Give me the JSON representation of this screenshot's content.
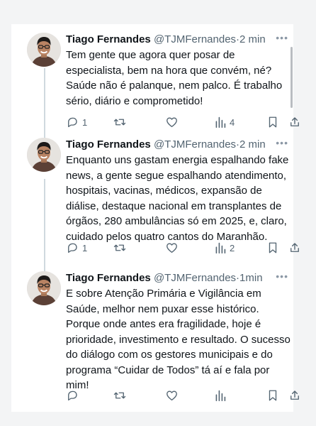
{
  "tweets": [
    {
      "name": "Tiago Fernandes",
      "handle": "@TJMFernandes",
      "separator": "·",
      "time": "2 min",
      "text": "Tem gente que agora quer posar de especialista, bem na hora que convém, né? Saúde não é palanque, nem palco. É trabalho sério, diário e comprometido!",
      "replies": "1",
      "retweets": "",
      "likes": "",
      "views": "4"
    },
    {
      "name": "Tiago Fernandes",
      "handle": "@TJMFernandes",
      "separator": "·",
      "time": "2 min",
      "text": "Enquanto uns gastam energia espalhando fake news, a gente segue espalhando atendimento, hospitais, vacinas, médicos, expansão de diálise, destaque nacional em transplantes de órgãos, 280 ambulâncias só em 2025, e, claro, cuidado pelos quatro cantos do Maranhão.",
      "replies": "1",
      "retweets": "",
      "likes": "",
      "views": "2"
    },
    {
      "name": "Tiago Fernandes",
      "handle": "@TJMFernandes",
      "separator": "·",
      "time": "1min",
      "text": "E sobre Atenção Primária e Vigilância em Saúde, melhor nem puxar esse histórico. Porque onde antes era fragilidade, hoje é prioridade, investimento e resultado. O sucesso do diálogo com os gestores municipais e do programa “Cuidar de Todos” tá aí e fala por mim!",
      "replies": "",
      "retweets": "",
      "likes": "",
      "views": ""
    }
  ],
  "icons": {
    "more": "more-icon",
    "reply": "reply-icon",
    "retweet": "retweet-icon",
    "like": "heart-icon",
    "views": "views-icon",
    "bookmark": "bookmark-icon",
    "share": "share-icon"
  },
  "colors": {
    "text": "#0f1419",
    "secondary": "#536471",
    "thread_line": "#cfd9de"
  }
}
